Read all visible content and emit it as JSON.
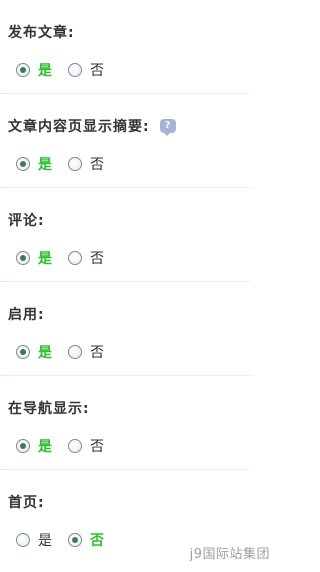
{
  "sections": [
    {
      "label": "发布文章:",
      "has_help": false,
      "options": [
        "是",
        "否"
      ],
      "selected": 0
    },
    {
      "label": "文章内容页显示摘要:",
      "has_help": true,
      "options": [
        "是",
        "否"
      ],
      "selected": 0
    },
    {
      "label": "评论:",
      "has_help": false,
      "options": [
        "是",
        "否"
      ],
      "selected": 0
    },
    {
      "label": "启用:",
      "has_help": false,
      "options": [
        "是",
        "否"
      ],
      "selected": 0
    },
    {
      "label": "在导航显示:",
      "has_help": false,
      "options": [
        "是",
        "否"
      ],
      "selected": 0
    },
    {
      "label": "首页:",
      "has_help": false,
      "options": [
        "是",
        "否"
      ],
      "selected": 1
    }
  ],
  "help_icon_text": "?",
  "watermark": "j9国际站集团",
  "colors": {
    "active_text": "#2fbf2f",
    "radio_dot": "#3e7a4e",
    "help_icon": "#a6b2d6"
  }
}
